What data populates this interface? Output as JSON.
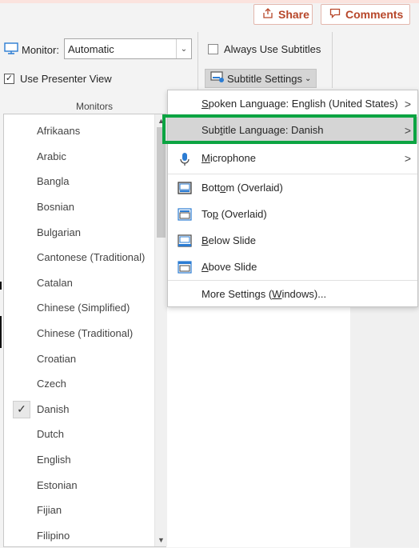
{
  "topbar": {
    "share_label": "Share",
    "comments_label": "Comments"
  },
  "ribbon": {
    "monitor_label": "Monitor:",
    "monitor_value": "Automatic",
    "presenter_view_label": "Use Presenter View",
    "presenter_view_checked": true,
    "group_label": "Monitors",
    "always_subtitles_label": "Always Use Subtitles",
    "always_subtitles_checked": false,
    "subtitle_settings_label": "Subtitle Settings"
  },
  "menu": {
    "spoken_language": {
      "pre": "",
      "key": "S",
      "post": "poken Language: English (United States)"
    },
    "subtitle_language": {
      "pre": "Sub",
      "key": "t",
      "post": "itle Language: Danish"
    },
    "microphone": {
      "pre": "",
      "key": "M",
      "post": "icrophone"
    },
    "bottom": {
      "pre": "Bott",
      "key": "o",
      "post": "m (Overlaid)"
    },
    "top": {
      "pre": "To",
      "key": "p",
      "post": " (Overlaid)"
    },
    "below": {
      "pre": "",
      "key": "B",
      "post": "elow Slide"
    },
    "above": {
      "pre": "",
      "key": "A",
      "post": "bove Slide"
    },
    "more": {
      "pre": "More Settings (",
      "key": "W",
      "post": "indows)..."
    }
  },
  "languages": [
    "Afrikaans",
    "Arabic",
    "Bangla",
    "Bosnian",
    "Bulgarian",
    "Cantonese (Traditional)",
    "Catalan",
    "Chinese (Simplified)",
    "Chinese (Traditional)",
    "Croatian",
    "Czech",
    "Danish",
    "Dutch",
    "English",
    "Estonian",
    "Fijian",
    "Filipino"
  ],
  "selected_language": "Danish",
  "colors": {
    "accent": "#b7472a",
    "highlight_border": "#0ca442",
    "icon_blue": "#2b7cd3"
  }
}
